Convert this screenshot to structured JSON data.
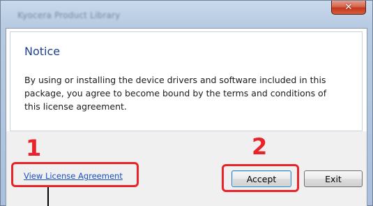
{
  "window": {
    "title": "Kyocera Product Library",
    "close_glyph": "✕"
  },
  "notice": {
    "title": "Notice",
    "body_lines": [
      "By using or installing the device drivers and software included in this",
      "package, you agree to become bound by the terms and conditions of",
      "this license agreement."
    ]
  },
  "footer": {
    "view_license_link": "View License Agreement",
    "accept_label": "Accept",
    "exit_label": "Exit"
  },
  "annotations": {
    "step1": "1",
    "step2": "2",
    "color": "#e8232a"
  },
  "icons": {
    "close": "close-icon"
  }
}
